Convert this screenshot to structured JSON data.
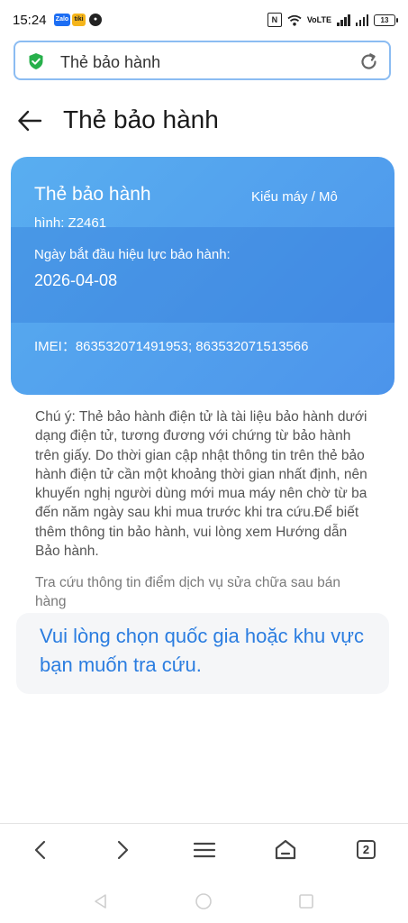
{
  "status_bar": {
    "time": "15:24",
    "app_badges": [
      "Zalo",
      "tiki"
    ],
    "network_label": "VoLTE",
    "battery": "13"
  },
  "url_bar": {
    "text": "Thẻ bảo hành",
    "secure_icon": "shield-check-icon",
    "reload_icon": "reload-icon"
  },
  "header": {
    "title": "Thẻ bảo hành"
  },
  "card": {
    "title": "Thẻ bảo hành",
    "model_label": "Kiểu máy / Mô",
    "model_value": "hình: Z2461",
    "start_label": "Ngày bắt đầu hiệu lực bảo hành:",
    "start_date": "2026-04-08",
    "imei": "IMEI：863532071491953; 863532071513566"
  },
  "note": "Chú ý: Thẻ bảo hành điện tử là tài liệu bảo hành dưới dạng điện tử, tương đương với chứng từ bảo hành trên giấy. Do thời gian cập nhật thông tin trên thẻ bảo hành điện tử cần một khoảng thời gian nhất định, nên khuyến nghị người dùng mới mua máy nên chờ từ ba đến năm ngày sau khi mua trước khi tra cứu.Để biết thêm thông tin bảo hành, vui lòng xem Hướng dẫn Bảo hành.",
  "lookup_label": "Tra cứu thông tin điểm dịch vụ sửa chữa sau bán hàng",
  "region_prompt": "Vui lòng chọn quốc gia hoặc khu vực bạn muốn tra cứu.",
  "toolbar": {
    "tabs_count": "2"
  },
  "colors": {
    "card_start": "#59aef0",
    "card_end": "#4c94eb",
    "link": "#2b7de0",
    "url_border": "#8bbcf2"
  }
}
